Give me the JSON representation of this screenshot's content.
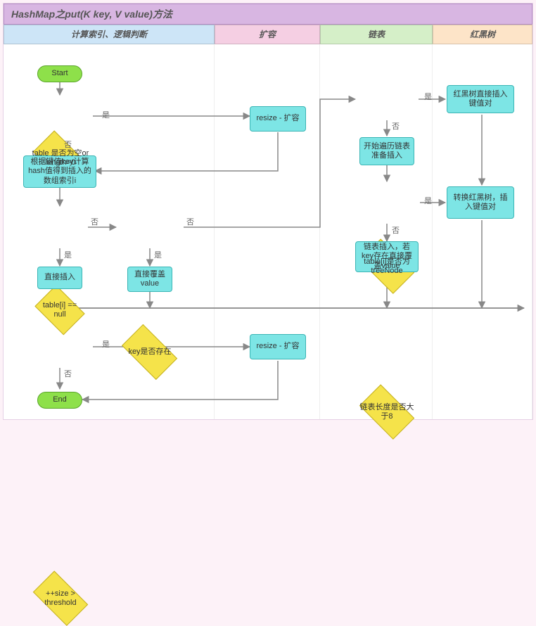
{
  "title": "HashMap之put(K key, V value)方法",
  "columns": {
    "c1": "计算索引、逻辑判断",
    "c2": "扩容",
    "c3": "链表",
    "c4": "红黑树"
  },
  "nodes": {
    "start": "Start",
    "end": "End",
    "d_table_empty": "table 是否为空or length=0",
    "p_resize1": "resize - 扩容",
    "p_hash": "根据键值key计算hash值得到插入的数组索引i",
    "d_null": "table[i] == null",
    "p_insert": "直接插入",
    "d_key_exist": "key是否存在",
    "p_override": "直接覆盖value",
    "d_treenode": "table[i]是否为treeNode",
    "p_rbtree_insert": "红黑树直接插入键值对",
    "p_traverse": "开始遍历链表准备插入",
    "d_len8": "链表长度是否大于8",
    "p_convert": "转换红黑树，插入键值对",
    "p_list_insert": "链表插入，若key存在直接覆盖value",
    "d_threshold": "++size > threshold",
    "p_resize2": "resize - 扩容"
  },
  "labels": {
    "yes": "是",
    "no": "否"
  },
  "chart_data": {
    "type": "flowchart",
    "title": "HashMap之put(K key, V value)方法",
    "swimlanes": [
      "计算索引、逻辑判断",
      "扩容",
      "链表",
      "红黑树"
    ],
    "elements": [
      {
        "id": "start",
        "type": "terminator",
        "lane": 0,
        "text": "Start"
      },
      {
        "id": "d_table_empty",
        "type": "decision",
        "lane": 0,
        "text": "table 是否为空or length=0"
      },
      {
        "id": "p_resize1",
        "type": "process",
        "lane": 1,
        "text": "resize - 扩容"
      },
      {
        "id": "p_hash",
        "type": "process",
        "lane": 0,
        "text": "根据键值key计算hash值得到插入的数组索引i"
      },
      {
        "id": "d_null",
        "type": "decision",
        "lane": 0,
        "text": "table[i] == null"
      },
      {
        "id": "p_insert",
        "type": "process",
        "lane": 0,
        "text": "直接插入"
      },
      {
        "id": "d_key_exist",
        "type": "decision",
        "lane": 0,
        "text": "key是否存在"
      },
      {
        "id": "p_override",
        "type": "process",
        "lane": 0,
        "text": "直接覆盖value"
      },
      {
        "id": "d_treenode",
        "type": "decision",
        "lane": 2,
        "text": "table[i]是否为treeNode"
      },
      {
        "id": "p_rbtree_insert",
        "type": "process",
        "lane": 3,
        "text": "红黑树直接插入键值对"
      },
      {
        "id": "p_traverse",
        "type": "process",
        "lane": 2,
        "text": "开始遍历链表准备插入"
      },
      {
        "id": "d_len8",
        "type": "decision",
        "lane": 2,
        "text": "链表长度是否大于8"
      },
      {
        "id": "p_convert",
        "type": "process",
        "lane": 3,
        "text": "转换红黑树，插入键值对"
      },
      {
        "id": "p_list_insert",
        "type": "process",
        "lane": 2,
        "text": "链表插入，若key存在直接覆盖value"
      },
      {
        "id": "d_threshold",
        "type": "decision",
        "lane": 0,
        "text": "++size > threshold"
      },
      {
        "id": "p_resize2",
        "type": "process",
        "lane": 1,
        "text": "resize - 扩容"
      },
      {
        "id": "end",
        "type": "terminator",
        "lane": 0,
        "text": "End"
      }
    ],
    "edges": [
      {
        "from": "start",
        "to": "d_table_empty"
      },
      {
        "from": "d_table_empty",
        "to": "p_resize1",
        "label": "是"
      },
      {
        "from": "d_table_empty",
        "to": "p_hash",
        "label": "否"
      },
      {
        "from": "p_resize1",
        "to": "p_hash"
      },
      {
        "from": "p_hash",
        "to": "d_null"
      },
      {
        "from": "d_null",
        "to": "p_insert",
        "label": "是"
      },
      {
        "from": "d_null",
        "to": "d_key_exist",
        "label": "否"
      },
      {
        "from": "d_key_exist",
        "to": "p_override",
        "label": "是"
      },
      {
        "from": "d_key_exist",
        "to": "d_treenode",
        "label": "否"
      },
      {
        "from": "d_treenode",
        "to": "p_rbtree_insert",
        "label": "是"
      },
      {
        "from": "d_treenode",
        "to": "p_traverse",
        "label": "否"
      },
      {
        "from": "p_traverse",
        "to": "d_len8"
      },
      {
        "from": "d_len8",
        "to": "p_convert",
        "label": "是"
      },
      {
        "from": "d_len8",
        "to": "p_list_insert",
        "label": "否"
      },
      {
        "from": "p_insert",
        "to": "d_threshold"
      },
      {
        "from": "p_override",
        "to": "d_threshold"
      },
      {
        "from": "p_rbtree_insert",
        "to": "d_threshold"
      },
      {
        "from": "p_convert",
        "to": "d_threshold"
      },
      {
        "from": "p_list_insert",
        "to": "d_threshold"
      },
      {
        "from": "d_threshold",
        "to": "p_resize2",
        "label": "是"
      },
      {
        "from": "d_threshold",
        "to": "end",
        "label": "否"
      },
      {
        "from": "p_resize2",
        "to": "end"
      }
    ]
  }
}
